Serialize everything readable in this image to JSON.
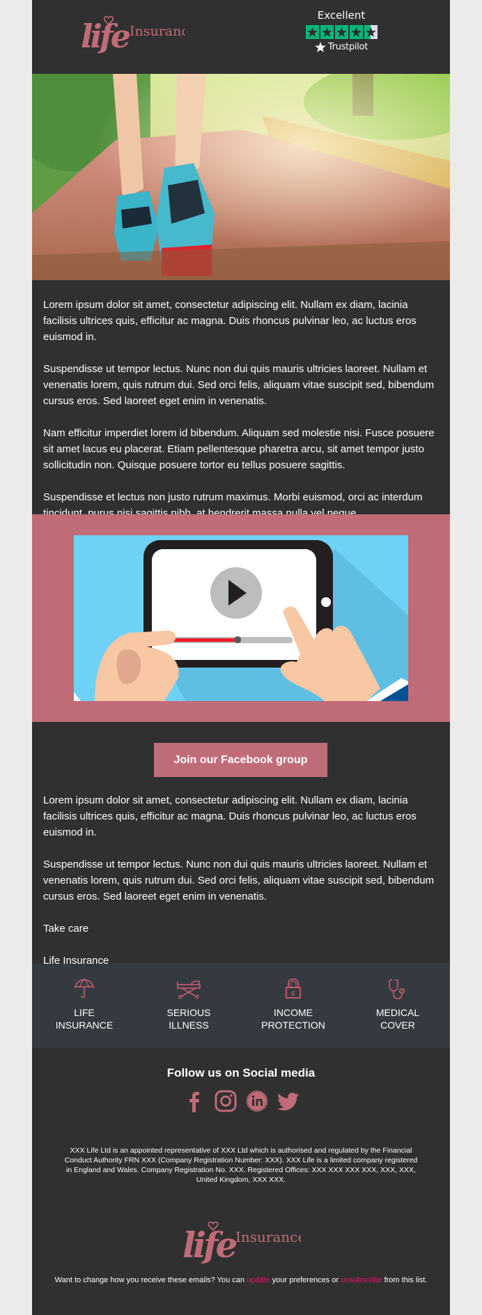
{
  "brand": {
    "logo_script": "life",
    "logo_word": "Insurance",
    "accent_color": "#c06c78",
    "link_color": "#e0176a",
    "background_color": "#303030"
  },
  "trustpilot": {
    "rating_label": "Excellent",
    "rating_stars": 4.5,
    "max_stars": 5,
    "brand": "Trustpilot"
  },
  "hero": {
    "image_description": "Close-up of a person's running shoes walking along a sunny park path"
  },
  "intro": {
    "paragraphs": [
      "Lorem ipsum dolor sit amet, consectetur adipiscing elit. Nullam ex diam, lacinia facilisis ultrices quis, efficitur ac magna. Duis rhoncus pulvinar leo, ac luctus eros euismod in.",
      "Suspendisse ut tempor lectus. Nunc non dui quis mauris ultricies laoreet. Nullam et venenatis lorem, quis rutrum dui. Sed orci felis, aliquam vitae suscipit sed, bibendum cursus eros. Sed laoreet eget enim in venenatis.",
      "Nam efficitur imperdiet lorem id bibendum. Aliquam sed molestie nisi. Fusce posuere sit amet lacus eu placerat. Etiam pellentesque pharetra arcu, sit amet tempor justo sollicitudin non. Quisque posuere tortor eu tellus posuere sagittis.",
      "Suspendisse et lectus non justo rutrum maximus. Morbi euismod, orci ac interdum tincidunt, purus nisi sagittis nibh, at hendrerit massa nulla vel neque."
    ]
  },
  "video": {
    "description": "Illustration of hands holding a tablet playing a video",
    "progress_fraction": 0.6,
    "play_icon": "play-icon"
  },
  "cta": {
    "label": "Join our Facebook group"
  },
  "closing": {
    "paragraphs": [
      "Lorem ipsum dolor sit amet, consectetur adipiscing elit. Nullam ex diam, lacinia facilisis ultrices quis, efficitur ac magna. Duis rhoncus pulvinar leo, ac luctus eros euismod in.",
      "Suspendisse ut tempor lectus. Nunc non dui quis mauris ultricies laoreet. Nullam et venenatis lorem, quis rutrum dui. Sed orci felis, aliquam vitae suscipit sed, bibendum cursus eros. Sed laoreet eget enim in venenatis."
    ],
    "signoff_line1": "Take care",
    "signoff_line2": "Life Insurance"
  },
  "services": [
    {
      "icon": "umbrella-icon",
      "label": "LIFE\nINSURANCE"
    },
    {
      "icon": "hospital-bed-icon",
      "label": "SERIOUS\nILLNESS"
    },
    {
      "icon": "padlock-pound-icon",
      "label": "INCOME\nPROTECTION"
    },
    {
      "icon": "stethoscope-icon",
      "label": "MEDICAL\nCOVER"
    }
  ],
  "social": {
    "title": "Follow us on Social media",
    "networks": [
      {
        "name": "Facebook",
        "icon": "facebook-icon"
      },
      {
        "name": "Instagram",
        "icon": "instagram-icon"
      },
      {
        "name": "LinkedIn",
        "icon": "linkedin-icon"
      },
      {
        "name": "Twitter",
        "icon": "twitter-icon"
      }
    ]
  },
  "footer": {
    "legal": "XXX Life Ltd is an appointed representative of XXX Ltd which is authorised and regulated by the Financial Conduct Authority FRN XXX (Company Registration Number: XXX). XXX Life is a limited company registered in England and Wales. Company Registration No. XXX. Registered Offices: XXX XXX XXX XXX, XXX, XXX, United Kingdom, XXX XXX.",
    "prefs_before": "Want to change how you receive these emails? You can ",
    "update_link": "update",
    "prefs_middle": " your preferences or ",
    "unsubscribe_link": "unsubscribe",
    "prefs_after": " from this list."
  }
}
